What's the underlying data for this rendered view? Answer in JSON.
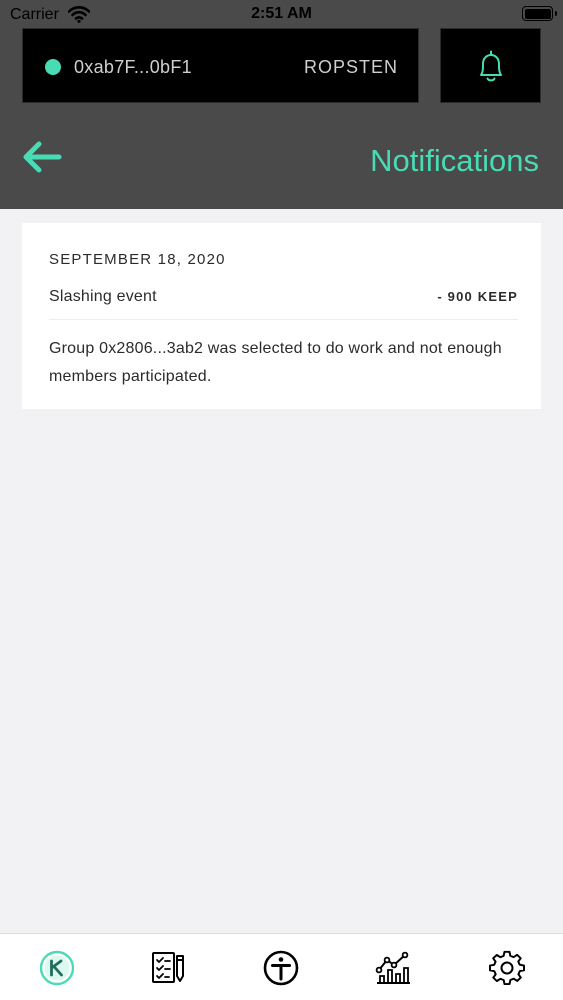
{
  "status_bar": {
    "carrier": "Carrier",
    "time": "2:51 AM"
  },
  "header": {
    "wallet_address": "0xab7F...0bF1",
    "network": "ROPSTEN",
    "title": "Notifications"
  },
  "notifications": [
    {
      "date": "SEPTEMBER 18, 2020",
      "event": "Slashing event",
      "amount": "- 900 KEEP",
      "description": "Group 0x2806...3ab2 was selected to do work and not enough members participated."
    }
  ],
  "tabs": [
    {
      "icon": "keep-logo-icon",
      "active": true
    },
    {
      "icon": "checklist-icon",
      "active": false
    },
    {
      "icon": "token-icon",
      "active": false
    },
    {
      "icon": "stats-chart-icon",
      "active": false
    },
    {
      "icon": "gear-icon",
      "active": false
    }
  ],
  "colors": {
    "accent": "#48DBB4",
    "header_bg": "#4A4A4A",
    "box_bg": "#000000",
    "page_bg": "#F2F1F4",
    "text": "#2B2B2B"
  }
}
